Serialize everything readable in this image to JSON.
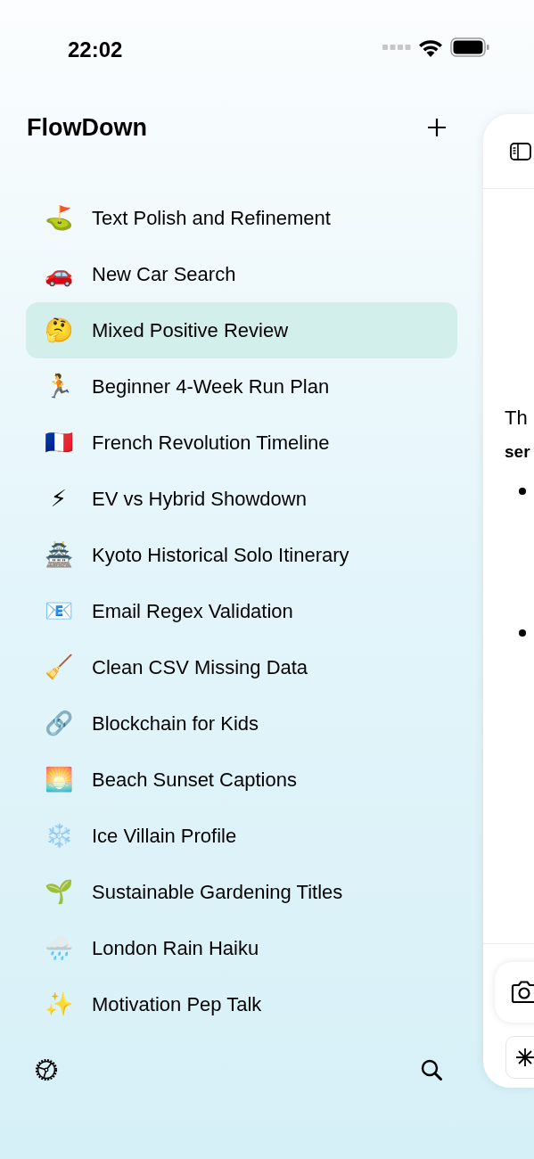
{
  "status_bar": {
    "time": "22:02"
  },
  "sidebar": {
    "title": "FlowDown",
    "items": [
      {
        "emoji": "⛳",
        "label": "Text Polish and Refinement",
        "selected": false
      },
      {
        "emoji": "🚗",
        "label": "New Car Search",
        "selected": false
      },
      {
        "emoji": "🤔",
        "label": "Mixed Positive Review",
        "selected": true
      },
      {
        "emoji": "🏃",
        "label": "Beginner 4-Week Run Plan",
        "selected": false
      },
      {
        "emoji": "🇫🇷",
        "label": "French Revolution Timeline",
        "selected": false
      },
      {
        "emoji": "⚡",
        "label": "EV vs Hybrid Showdown",
        "selected": false
      },
      {
        "emoji": "🏯",
        "label": "Kyoto Historical Solo Itinerary",
        "selected": false
      },
      {
        "emoji": "📧",
        "label": "Email Regex Validation",
        "selected": false
      },
      {
        "emoji": "🧹",
        "label": "Clean CSV Missing Data",
        "selected": false
      },
      {
        "emoji": "🔗",
        "label": "Blockchain for Kids",
        "selected": false
      },
      {
        "emoji": "🌅",
        "label": "Beach Sunset Captions",
        "selected": false
      },
      {
        "emoji": "❄️",
        "label": "Ice Villain Profile",
        "selected": false
      },
      {
        "emoji": "🌱",
        "label": "Sustainable Gardening Titles",
        "selected": false
      },
      {
        "emoji": "🌧️",
        "label": "London Rain Haiku",
        "selected": false
      },
      {
        "emoji": "✨",
        "label": "Motivation Pep Talk",
        "selected": false
      }
    ]
  },
  "chat": {
    "line_1": "Th",
    "line_2": "ser"
  }
}
